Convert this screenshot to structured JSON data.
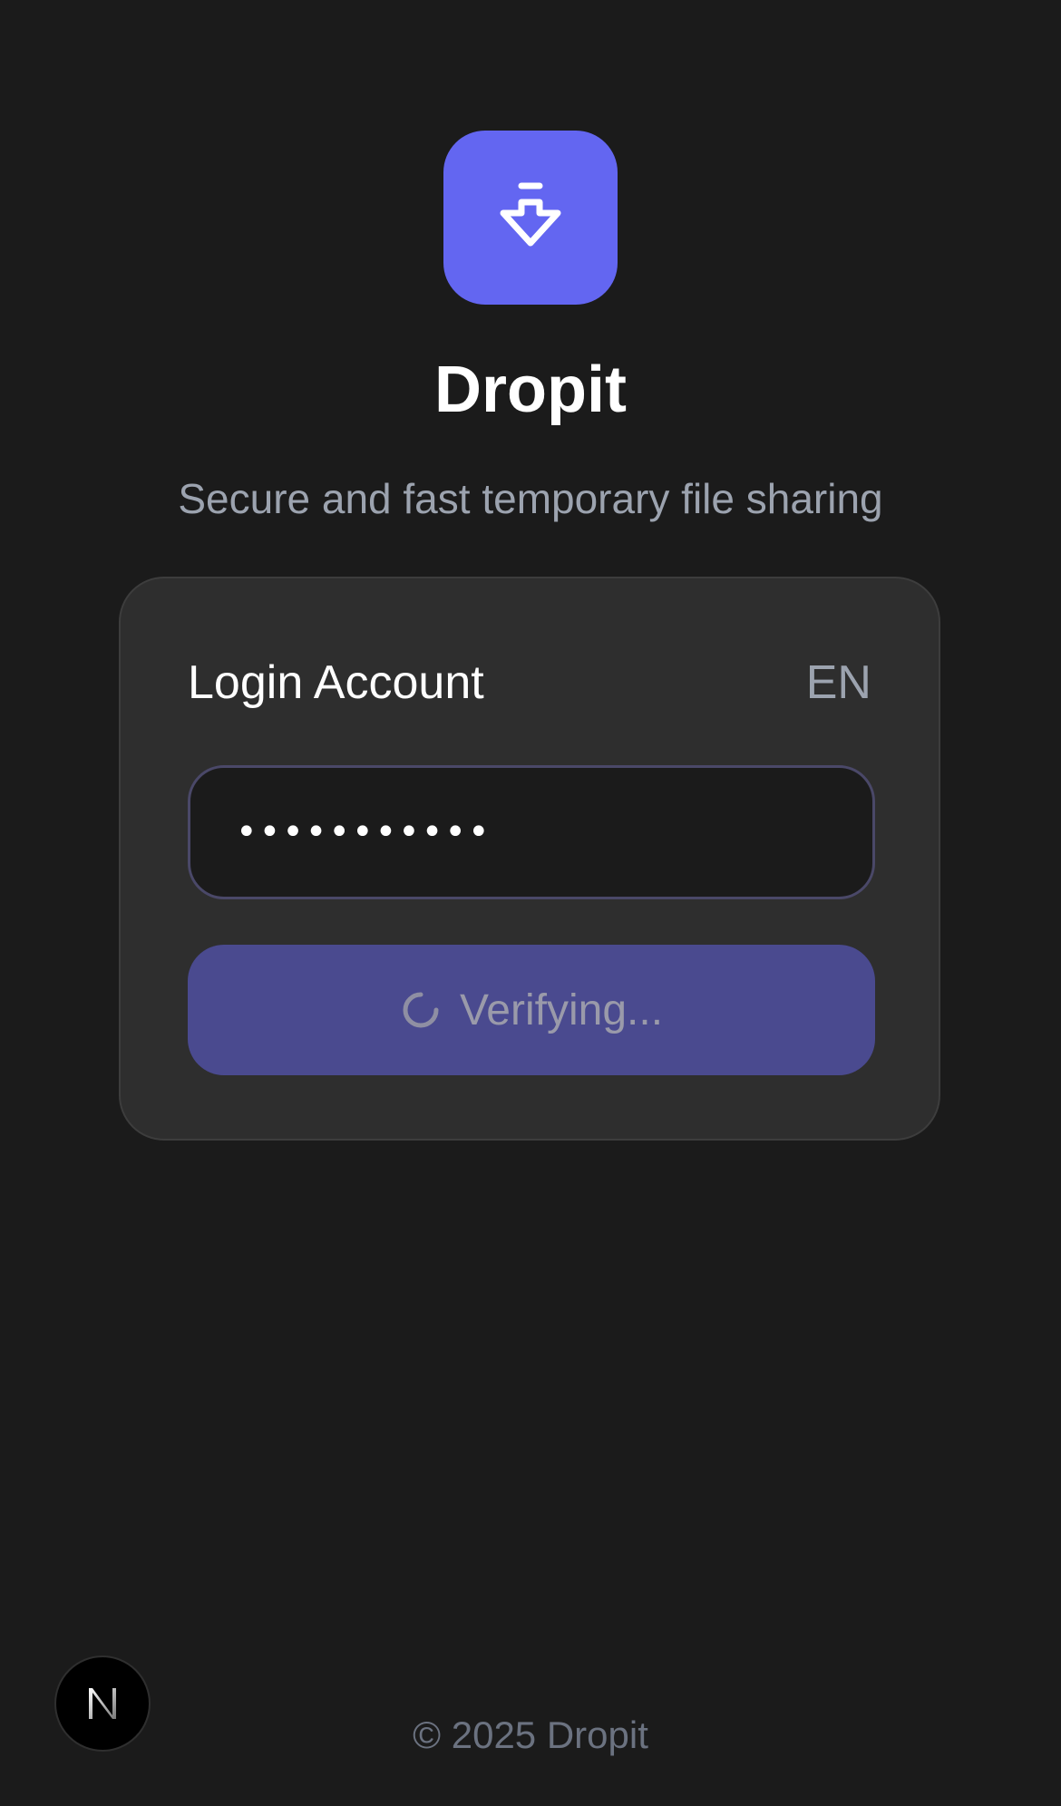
{
  "app": {
    "name": "Dropit",
    "tagline": "Secure and fast temporary file sharing",
    "logo_icon": "download-arrow-icon",
    "accent_color": "#6366f1"
  },
  "login": {
    "title": "Login Account",
    "language": "EN",
    "password_value": "•••••••••••",
    "button_label": "Verifying...",
    "button_icon": "spinner-icon",
    "button_color": "#4a4a8f"
  },
  "footer": {
    "copyright": "© 2025 Dropit"
  },
  "devtools": {
    "badge_icon": "nextjs-icon"
  }
}
